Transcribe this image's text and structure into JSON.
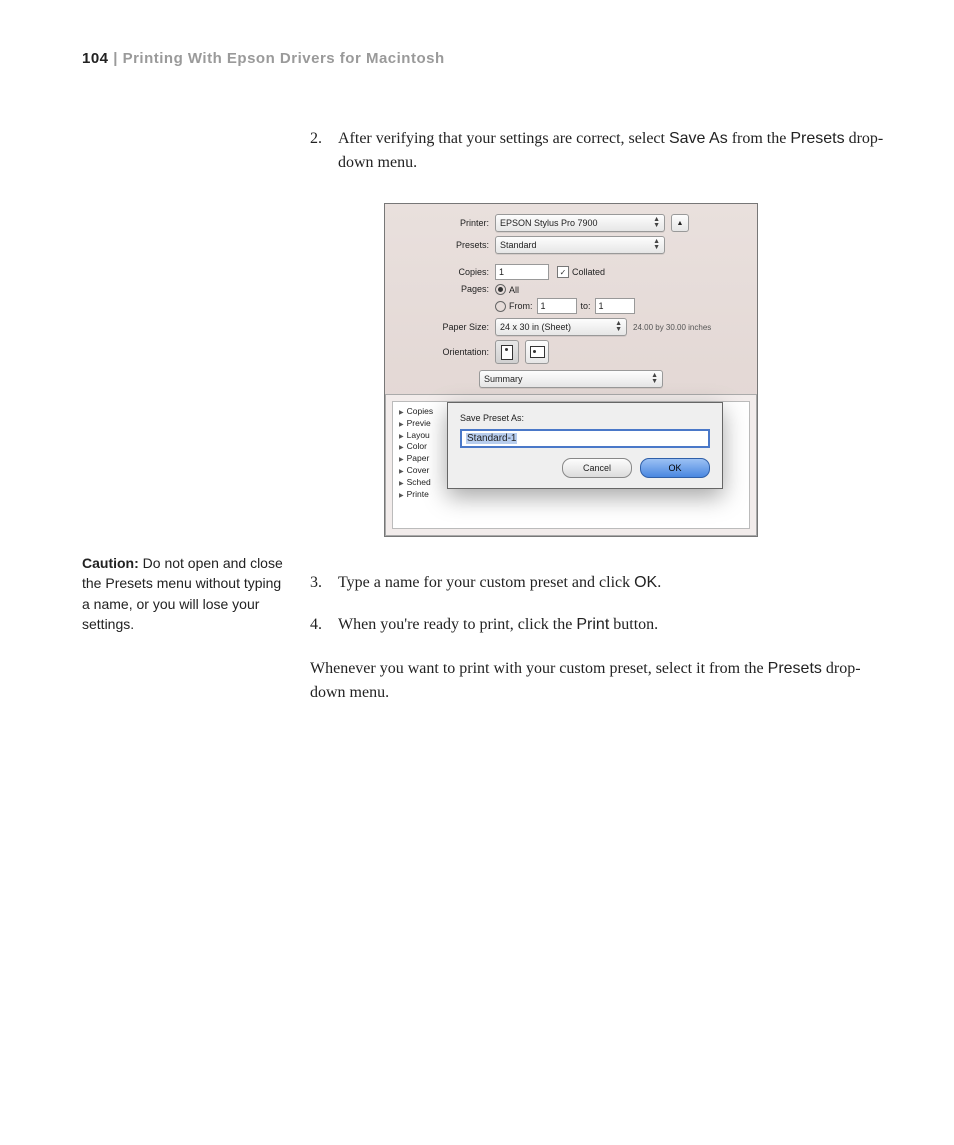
{
  "header": {
    "page_number": "104",
    "separator": " | ",
    "title": "Printing With Epson Drivers for Macintosh"
  },
  "steps": {
    "s2": {
      "num": "2.",
      "pre": "After verifying that your settings are correct, select ",
      "term1": "Save As",
      "mid": " from the ",
      "term2": "Presets",
      "post": " drop-down menu."
    },
    "s3": {
      "num": "3.",
      "pre": "Type a name for your custom preset and click ",
      "term1": "OK",
      "post": "."
    },
    "s4": {
      "num": "4.",
      "pre": "When you're ready to print, click the ",
      "term1": "Print",
      "post": " button."
    }
  },
  "closing": {
    "pre": "Whenever you want to print with your custom preset, select it from the ",
    "term1": "Presets",
    "post": " drop-down menu."
  },
  "caution": {
    "label": "Caution:",
    "text": " Do not open and close the Presets menu without typing a name, or you will lose your settings."
  },
  "dialog": {
    "printer_label": "Printer:",
    "printer_value": "EPSON Stylus Pro 7900",
    "presets_label": "Presets:",
    "presets_value": "Standard",
    "copies_label": "Copies:",
    "copies_value": "1",
    "collated_label": "Collated",
    "pages_label": "Pages:",
    "all_label": "All",
    "from_label": "From:",
    "from_value": "1",
    "to_label": "to:",
    "to_value": "1",
    "papersize_label": "Paper Size:",
    "papersize_value": "24 x 30 in (Sheet)",
    "papersize_hint": "24.00 by 30.00 inches",
    "orientation_label": "Orientation:",
    "section_value": "Summary",
    "summary_items": [
      "Copies",
      "Previe",
      "Layou",
      "Color",
      "Paper",
      "Cover",
      "Sched",
      "Printe"
    ],
    "sheet_label": "Save Preset As:",
    "sheet_value": "Standard-1",
    "cancel": "Cancel",
    "ok": "OK"
  }
}
